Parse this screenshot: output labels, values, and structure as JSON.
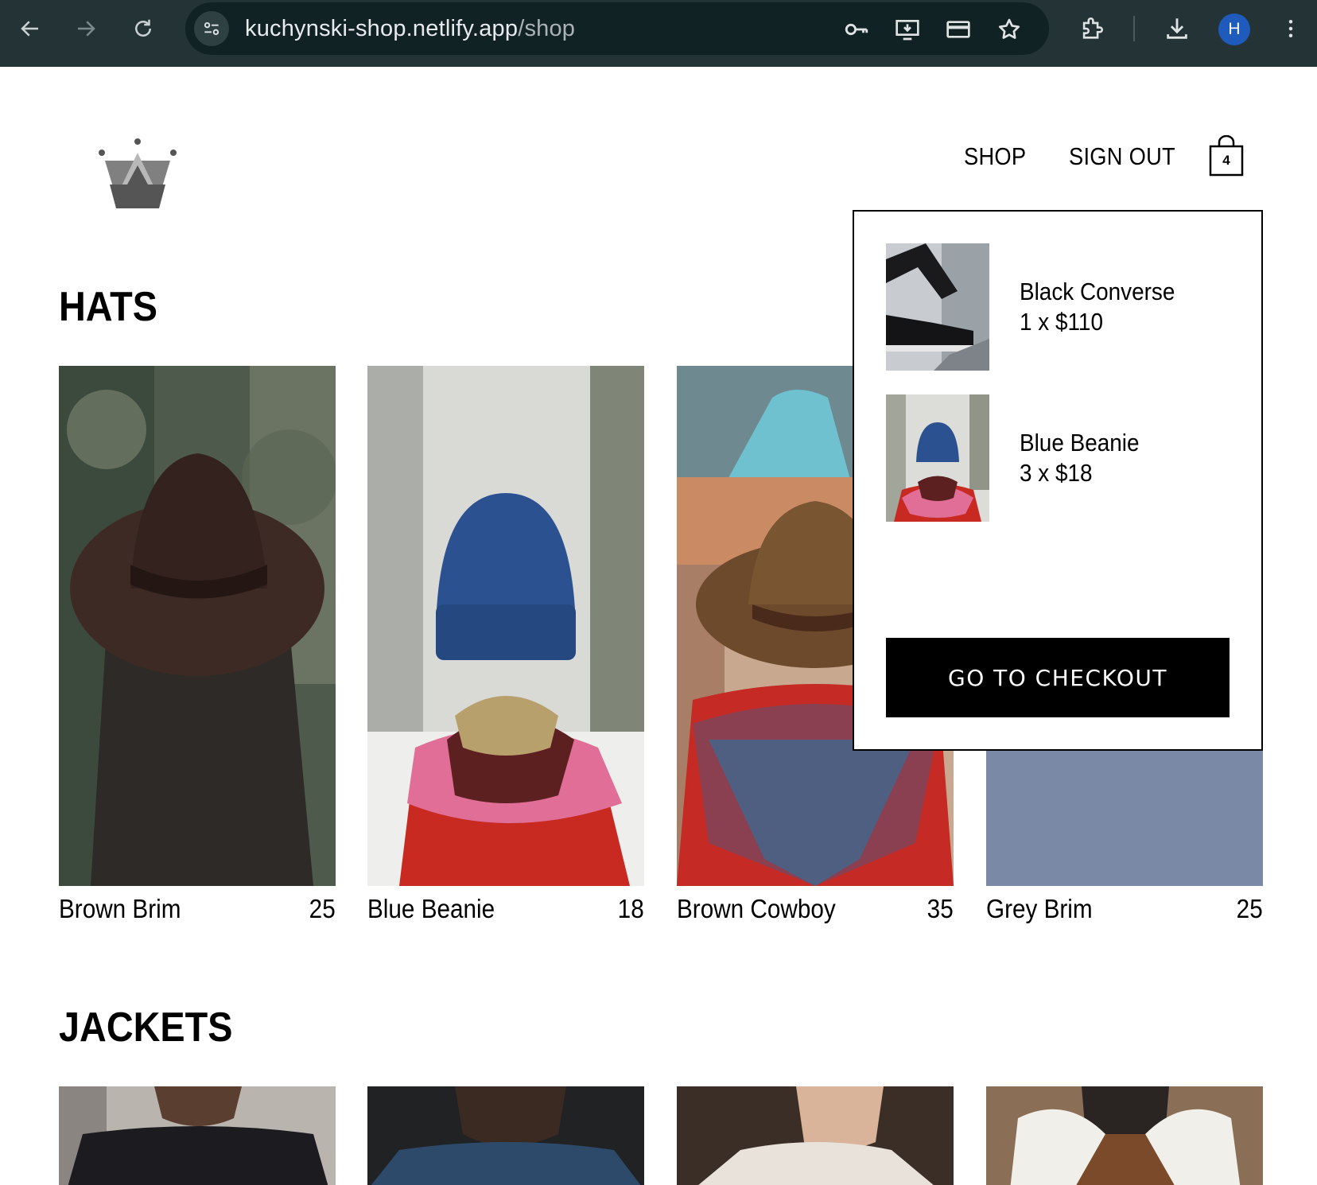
{
  "browser": {
    "url_host": "kuchynski-shop.netlify.app",
    "url_path": "/shop",
    "profile_initial": "H",
    "icons": [
      "back-icon",
      "forward-icon",
      "reload-icon",
      "site-info-icon",
      "key-icon",
      "install-app-icon",
      "card-icon",
      "bookmark-star-icon",
      "extensions-icon",
      "download-icon",
      "menu-icon"
    ]
  },
  "header": {
    "logo": "crown-logo",
    "nav": [
      {
        "label": "SHOP"
      },
      {
        "label": "SIGN OUT"
      }
    ],
    "cart_count": "4"
  },
  "sections": [
    {
      "title": "HATS",
      "items": [
        {
          "name": "Brown Brim",
          "price": "25"
        },
        {
          "name": "Blue Beanie",
          "price": "18"
        },
        {
          "name": "Brown Cowboy",
          "price": "35"
        },
        {
          "name": "Grey Brim",
          "price": "25"
        }
      ]
    },
    {
      "title": "JACKETS",
      "items": []
    }
  ],
  "cart": {
    "items": [
      {
        "name": "Black Converse",
        "quantity_price": "1 x $110"
      },
      {
        "name": "Blue Beanie",
        "quantity_price": "3 x $18"
      }
    ],
    "checkout_label": "GO TO CHECKOUT"
  },
  "colors": {
    "chrome_bg": "#243436",
    "omnibox_bg": "#112224",
    "accent_avatar": "#1e5bbd",
    "button_bg": "#000000"
  }
}
